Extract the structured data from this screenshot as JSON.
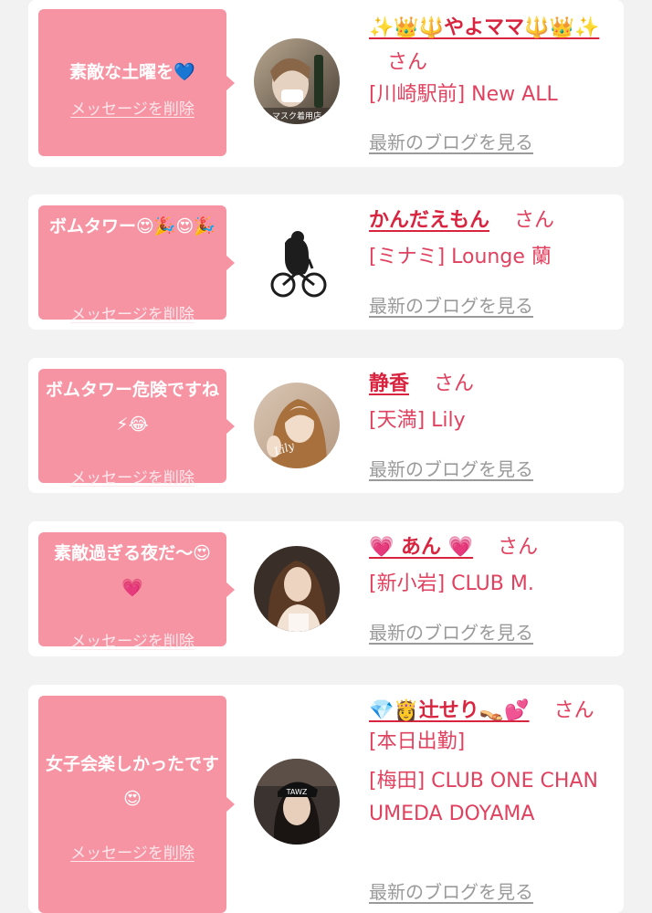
{
  "items": [
    {
      "message": "素敵な土曜を💙",
      "delete_label": "メッセージを削除",
      "avatar_text": "マスク着用店",
      "name": "✨👑🔱やよママ🔱👑✨",
      "san": "さん",
      "shop": "[川崎駅前] New ALL",
      "blog_label": "最新のブログを見る"
    },
    {
      "message": "ボムタワー😍🎉😍🎉",
      "delete_label": "メッセージを削除",
      "name": "かんだえもん",
      "san": "さん",
      "shop": "[ミナミ] Lounge 蘭",
      "blog_label": "最新のブログを見る"
    },
    {
      "message": "ボムタワー危険ですね⚡😂",
      "delete_label": "メッセージを削除",
      "name": "静香",
      "san": "さん",
      "shop": "[天満] Lily",
      "blog_label": "最新のブログを見る"
    },
    {
      "message": "素敵過ぎる夜だ〜😍💗",
      "delete_label": "メッセージを削除",
      "name": "💗 あん 💗",
      "san": "さん",
      "shop": "[新小岩] CLUB M.",
      "blog_label": "最新のブログを見る"
    },
    {
      "message": "女子会楽しかったです😍",
      "delete_label": "メッセージを削除",
      "name": "💎👸辻せり👡💕",
      "san": "さん[本日出勤]",
      "shop": "[梅田] CLUB ONE CHAN UMEDA DOYAMA",
      "blog_label": "最新のブログを見る"
    }
  ],
  "colors": {
    "bubble": "#f794a3",
    "name": "#d8243f",
    "text": "#e0415f",
    "link_gray": "#9a9a9a",
    "background": "#f2f2f2"
  }
}
